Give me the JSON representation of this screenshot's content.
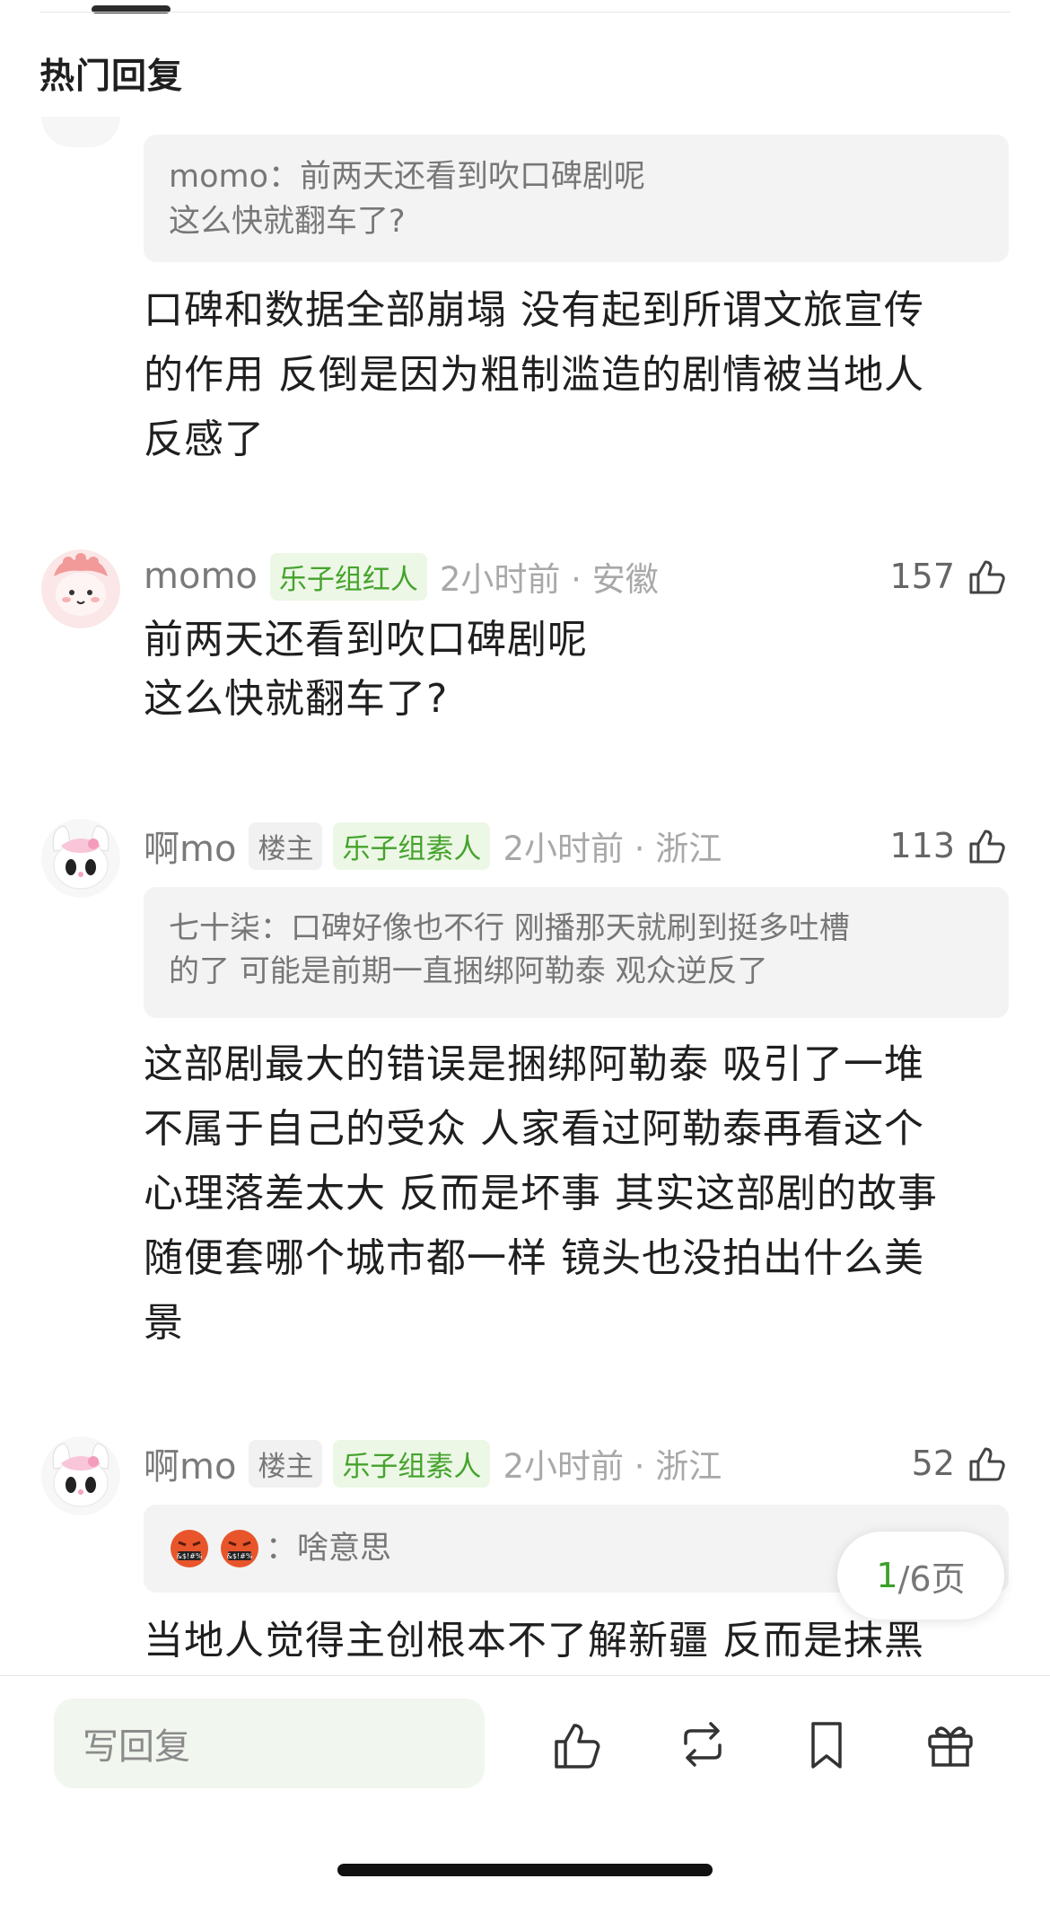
{
  "section": {
    "title": "热门回复"
  },
  "first": {
    "quote_author": "momo：",
    "quote_text": "前两天还看到吹口碑剧呢\n这么快就翻车了?",
    "content": "口碑和数据全部崩塌 没有起到所谓文旅宣传\n的作用 反倒是因为粗制滥造的剧情被当地人\n反感了"
  },
  "c2": {
    "username": "momo",
    "group_badge": "乐子组红人",
    "meta": "2小时前 · 安徽",
    "likes": "157",
    "content": "前两天还看到吹口碑剧呢\n这么快就翻车了?"
  },
  "c3": {
    "username": "啊mo",
    "owner_badge": "楼主",
    "group_badge": "乐子组素人",
    "meta": "2小时前 · 浙江",
    "likes": "113",
    "quote_author": "七十柒：",
    "quote_text": "口碑好像也不行 刚播那天就刷到挺多吐槽\n的了 可能是前期一直捆绑阿勒泰 观众逆反了",
    "content": "这部剧最大的错误是捆绑阿勒泰 吸引了一堆\n不属于自己的受众 人家看过阿勒泰再看这个\n心理落差太大 反而是坏事 其实这部剧的故事\n随便套哪个城市都一样 镜头也没拍出什么美\n景"
  },
  "c4": {
    "username": "啊mo",
    "owner_badge": "楼主",
    "group_badge": "乐子组素人",
    "meta": "2小时前 · 浙江",
    "likes": "52",
    "quote_emoji_icons": [
      "angry-swearing-face-icon",
      "angry-swearing-face-icon"
    ],
    "quote_author": "：",
    "quote_text": "啥意思",
    "content": "当地人觉得主创根本不了解新疆 反而是抹黑"
  },
  "pagination": {
    "current": "1",
    "total": "/6页"
  },
  "bottom_bar": {
    "reply_placeholder": "写回复",
    "icons": [
      "thumbs-up-icon",
      "repost-icon",
      "bookmark-icon",
      "gift-icon"
    ]
  },
  "colors": {
    "accent_green": "#45a32c",
    "badge_green_bg": "#ecf7e6",
    "quote_bg": "#f3f3f3"
  }
}
